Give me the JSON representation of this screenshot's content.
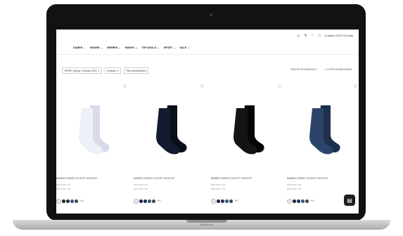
{
  "device": {
    "brand": "MacBook"
  },
  "header": {
    "cart_label": "(0 Artikel, EUR 0,00 total)",
    "icons": [
      "user-icon",
      "search-icon",
      "heart-icon",
      "bag-icon"
    ]
  },
  "nav": {
    "items": [
      {
        "label": "DAMEN"
      },
      {
        "label": "KINDER"
      },
      {
        "label": "HERREN"
      },
      {
        "label": "MARKE"
      },
      {
        "label": "TOP-DEALS"
      },
      {
        "label": "SPORT"
      },
      {
        "label": "SALE"
      }
    ]
  },
  "filters": {
    "chips": [
      {
        "label": "SPORT Spring / Summer 2021"
      },
      {
        "label": "schwarz"
      }
    ],
    "reset_label": "Filter zurücksetzen",
    "hide_filters_label": "FILTER AUSBLENDEN",
    "products_label": "PRODUKTE ANZEIGEN"
  },
  "products": [
    {
      "name": "BAMBOO UNISEX CA-SOFT SOCKS 2P",
      "price": "RRP EUR 9,95",
      "sale": "RRP EUR 7,95",
      "sock_color": "#eef0f7",
      "sock_shade": "#d9dce8",
      "swatches": [
        "#e8e8ea",
        "#1a2a4a",
        "#2b3340",
        "#3a5a86",
        "#4a4a4a"
      ],
      "more": "+10"
    },
    {
      "name": "BAMBOO UNISEX CA-SOFT SOCKS 2P",
      "price": "RRP EUR 9,95",
      "sale": "RRP EUR 7,95",
      "sock_color": "#121a2e",
      "sock_shade": "#0a0f1c",
      "swatches": [
        "#e8e8ea",
        "#1a2a4a",
        "#2b3340",
        "#3a5a86",
        "#4a4a4a"
      ],
      "more": "+10"
    },
    {
      "name": "BAMBOO UNISEX CA-SOFT SOCKS 2P",
      "price": "RRP EUR 9,95",
      "sale": "RRP EUR 7,95",
      "sock_color": "#141414",
      "sock_shade": "#050505",
      "swatches": [
        "#e8e8ea",
        "#1a2a4a",
        "#2b3340",
        "#3a5a86",
        "#4a4a4a"
      ],
      "more": "+10"
    },
    {
      "name": "BAMBOO UNISEX CA-SOFT SOCKS 2P",
      "price": "RRP EUR 9,95",
      "sale": "RRP EUR 7,95",
      "sock_color": "#2c4469",
      "sock_shade": "#1c2f4d",
      "swatches": [
        "#e8e8ea",
        "#1a2a4a",
        "#2b3340",
        "#3a5a86",
        "#4a4a4a"
      ],
      "more": "+10"
    }
  ]
}
